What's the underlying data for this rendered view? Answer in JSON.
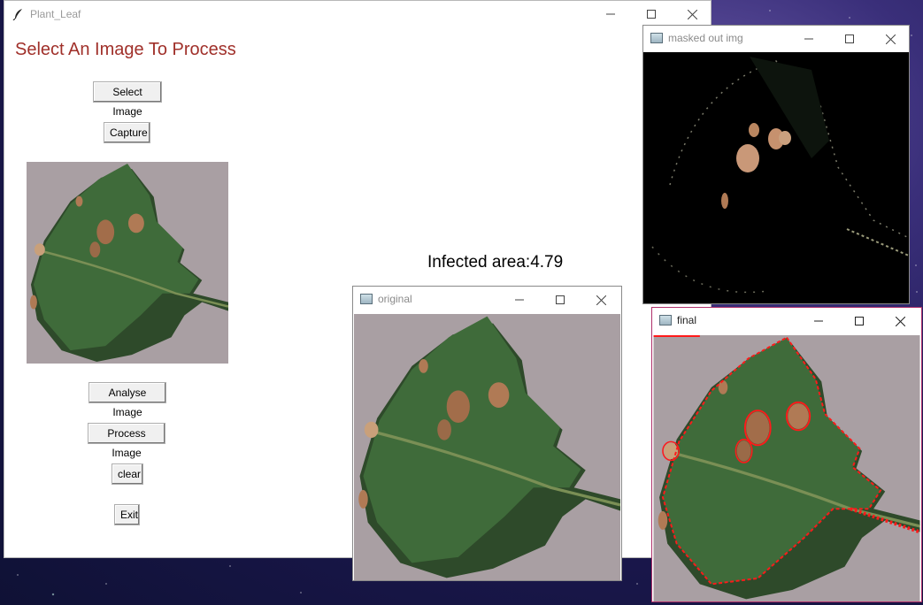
{
  "main_window": {
    "title": "Plant_Leaf",
    "heading": "Select An Image To Process",
    "buttons": {
      "select_image": "Select Image",
      "capture": "Capture",
      "analyse_image": "Analyse Image",
      "process_image": "Process Image",
      "clear": "clear",
      "exit": "Exit"
    },
    "infected_area_text": "Infected area:4.79"
  },
  "windows": {
    "masked": {
      "title": "masked out img"
    },
    "original": {
      "title": "original"
    },
    "final": {
      "title": "final"
    }
  },
  "colors": {
    "heading": "#a0302a",
    "leaf_green": "#3f6b3a",
    "background_gray": "#a89ea0",
    "spot_brown": "#b07a55",
    "contour_red": "#ff1a1a"
  }
}
